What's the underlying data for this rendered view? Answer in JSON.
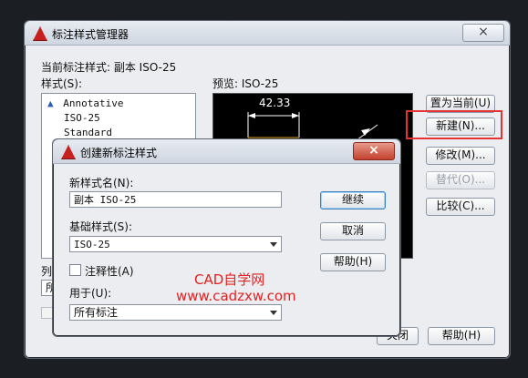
{
  "main_dialog": {
    "title": "标注样式管理器",
    "current_style": "当前标注样式: 副本 ISO-25",
    "styles_label": "样式(S):",
    "styles": [
      "Annotative",
      "ISO-25",
      "Standard"
    ],
    "preview_label": "预览: ISO-25",
    "preview_dimension": "42.33",
    "list_label_partial": "列",
    "list_value_partial": "所",
    "buttons": {
      "set_current": "置为当前(U)",
      "new": "新建(N)...",
      "modify": "修改(M)...",
      "override": "替代(O)...",
      "compare": "比较(C)...",
      "close_partial": "关闭",
      "help": "帮助(H)"
    },
    "close_glyph": "×",
    "highlight_color": "#e53333"
  },
  "new_style_dialog": {
    "title": "创建新标注样式",
    "name_label": "新样式名(N):",
    "name_value": "副本 ISO-25",
    "base_label": "基础样式(S):",
    "base_value": "ISO-25",
    "annotative_label": "注释性(A)",
    "use_for_label": "用于(U):",
    "use_for_value": "所有标注",
    "buttons": {
      "continue": "继续",
      "cancel": "取消",
      "help": "帮助(H)"
    },
    "close_glyph": "×"
  },
  "watermark": {
    "line1": "CAD自学网",
    "line2": "www.cadzxw.com"
  }
}
